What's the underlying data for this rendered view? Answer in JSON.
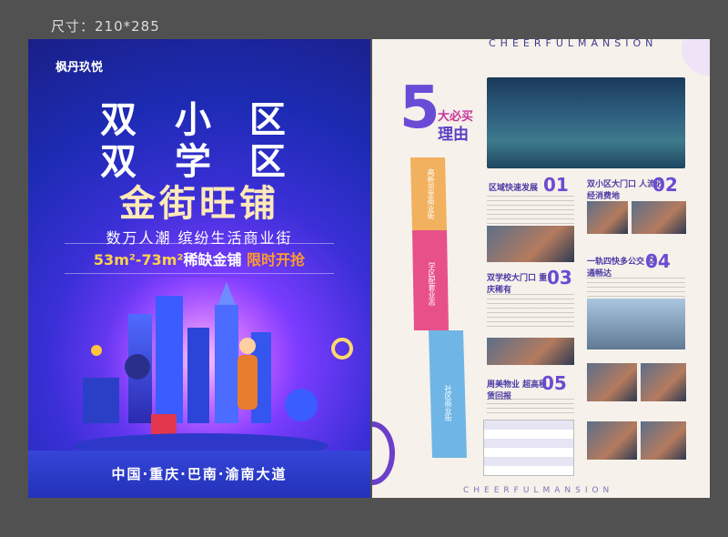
{
  "size_label": "尺寸：210*285",
  "left_poster": {
    "brand": "枫丹玖悦",
    "headline_1": "双 小 区",
    "headline_2": "双 学 区",
    "headline_3": "金街旺铺",
    "subtitle": "数万人潮  缤纷生活商业街",
    "offer_prefix": "53m²-73m²",
    "offer_middle": "稀缺金铺",
    "offer_suffix": "限时开抢",
    "footer": "中国·重庆·巴南·渝南大道"
  },
  "right_poster": {
    "top_banner": "CHEERFULMANSION",
    "bottom_banner": "CHEERFULMANSION",
    "five_number": "5",
    "five_sub1": "大必买",
    "five_sub2": "理由",
    "strip_labels": [
      "高新邻里商业街",
      "学区配套业态",
      "社区商业街"
    ],
    "reasons": [
      {
        "num": "01",
        "title": "区域快速发展"
      },
      {
        "num": "02",
        "title": "双小区大门口 人流必经消费地"
      },
      {
        "num": "03",
        "title": "双学校大门口 重庆稀有"
      },
      {
        "num": "04",
        "title": "一轨四快多公交 交通畅达"
      },
      {
        "num": "05",
        "title": "周美物业 超高租赁回报"
      }
    ]
  }
}
